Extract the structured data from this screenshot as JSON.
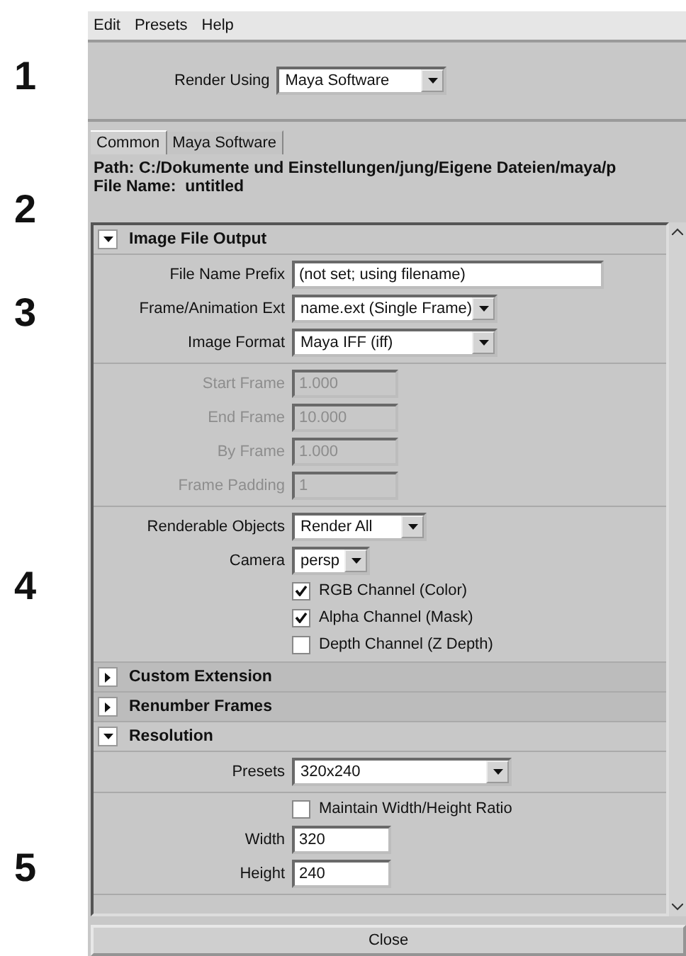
{
  "annotations": [
    "1",
    "2",
    "3",
    "4",
    "5"
  ],
  "menu": [
    "Edit",
    "Presets",
    "Help"
  ],
  "render_using": {
    "label": "Render Using",
    "value": "Maya Software"
  },
  "tabs": [
    {
      "label": "Common",
      "selected": true
    },
    {
      "label": "Maya Software",
      "selected": false
    }
  ],
  "path": {
    "label": "Path:",
    "value": "C:/Dokumente und Einstellungen/jung/Eigene Dateien/maya/p"
  },
  "file_name": {
    "label": "File Name:",
    "value": "untitled"
  },
  "sections": [
    {
      "title": "Image File Output",
      "expanded": true,
      "groups": [
        [
          {
            "kind": "field",
            "label": "File Name Prefix",
            "value": "(not set; using filename)",
            "disabled": false
          },
          {
            "kind": "dropdown",
            "label": "Frame/Animation Ext",
            "value": "name.ext (Single Frame)"
          },
          {
            "kind": "dropdown",
            "label": "Image Format",
            "value": "Maya IFF (iff)"
          }
        ],
        [
          {
            "kind": "field",
            "label": "Start Frame",
            "value": "1.000",
            "disabled": true
          },
          {
            "kind": "field",
            "label": "End Frame",
            "value": "10.000",
            "disabled": true
          },
          {
            "kind": "field",
            "label": "By Frame",
            "value": "1.000",
            "disabled": true
          },
          {
            "kind": "field",
            "label": "Frame Padding",
            "value": "1",
            "disabled": true
          }
        ],
        [
          {
            "kind": "dropdown",
            "label": "Renderable Objects",
            "value": "Render All"
          },
          {
            "kind": "dropdown",
            "label": "Camera",
            "value": "persp"
          },
          {
            "kind": "checkbox",
            "label": "RGB Channel (Color)",
            "checked": true
          },
          {
            "kind": "checkbox",
            "label": "Alpha Channel (Mask)",
            "checked": true
          },
          {
            "kind": "checkbox",
            "label": "Depth Channel (Z Depth)",
            "checked": false
          }
        ]
      ]
    },
    {
      "title": "Custom Extension",
      "expanded": false
    },
    {
      "title": "Renumber Frames",
      "expanded": false
    },
    {
      "title": "Resolution",
      "expanded": true,
      "groups": [
        [
          {
            "kind": "dropdown",
            "label": "Presets",
            "value": "320x240"
          }
        ],
        [
          {
            "kind": "checkbox",
            "label": "Maintain Width/Height Ratio",
            "checked": false
          },
          {
            "kind": "field",
            "label": "Width",
            "value": "320",
            "disabled": false
          },
          {
            "kind": "field",
            "label": "Height",
            "value": "240",
            "disabled": false
          }
        ]
      ]
    }
  ],
  "close_button": "Close"
}
